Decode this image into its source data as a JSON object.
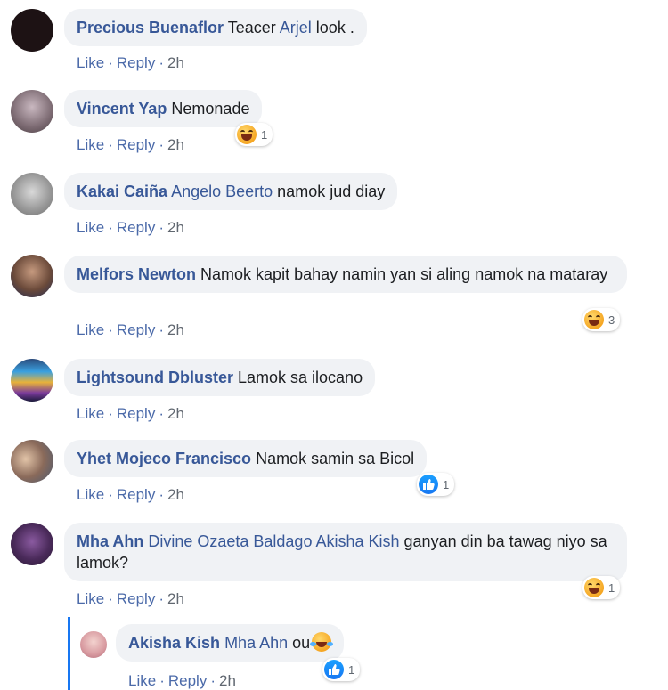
{
  "actions": {
    "like": "Like",
    "reply": "Reply",
    "dot": "·"
  },
  "comments": [
    {
      "author": "Precious Buenaflor",
      "parts": [
        {
          "t": "text",
          "v": "Teacer "
        },
        {
          "t": "mention",
          "v": "Arjel"
        },
        {
          "t": "text",
          "v": " look ."
        }
      ],
      "time": "2h",
      "reaction": null
    },
    {
      "author": "Vincent Yap",
      "parts": [
        {
          "t": "text",
          "v": "Nemonade"
        }
      ],
      "time": "2h",
      "reaction": {
        "type": "haha",
        "count": "1"
      }
    },
    {
      "author": "Kakai Caiña",
      "parts": [
        {
          "t": "mention",
          "v": "Angelo Beerto"
        },
        {
          "t": "text",
          "v": " namok jud diay"
        }
      ],
      "time": "2h",
      "reaction": null
    },
    {
      "author": "Melfors Newton",
      "parts": [
        {
          "t": "text",
          "v": "Namok kapit bahay namin yan si aling namok na mataray"
        }
      ],
      "time": "2h",
      "reaction": {
        "type": "haha",
        "count": "3"
      }
    },
    {
      "author": "Lightsound Dbluster",
      "parts": [
        {
          "t": "text",
          "v": "Lamok sa ilocano"
        }
      ],
      "time": "2h",
      "reaction": null
    },
    {
      "author": "Yhet Mojeco Francisco",
      "parts": [
        {
          "t": "text",
          "v": "Namok samin sa Bicol"
        }
      ],
      "time": "2h",
      "reaction": {
        "type": "like",
        "count": "1"
      }
    },
    {
      "author": "Mha Ahn",
      "parts": [
        {
          "t": "mention",
          "v": "Divine Ozaeta Baldago"
        },
        {
          "t": "text",
          "v": " "
        },
        {
          "t": "mention",
          "v": "Akisha Kish"
        },
        {
          "t": "text",
          "v": " ganyan din ba tawag niyo sa lamok?"
        }
      ],
      "time": "2h",
      "reaction": {
        "type": "haha",
        "count": "1"
      }
    },
    {
      "author": "Akisha Kish",
      "parts": [
        {
          "t": "mention",
          "v": "Mha Ahn"
        },
        {
          "t": "text",
          "v": " ou"
        }
      ],
      "time": "2h",
      "reaction": {
        "type": "like",
        "count": "1"
      }
    }
  ],
  "colors": {
    "link": "#385898",
    "bubble": "#f0f2f5",
    "thread": "#1877f2",
    "like": "#1877f2",
    "haha": "#f5a623"
  },
  "icons": {
    "haha": "haha-reaction-icon",
    "like": "like-reaction-icon",
    "laugh": "rolling-laughing-emoji"
  }
}
